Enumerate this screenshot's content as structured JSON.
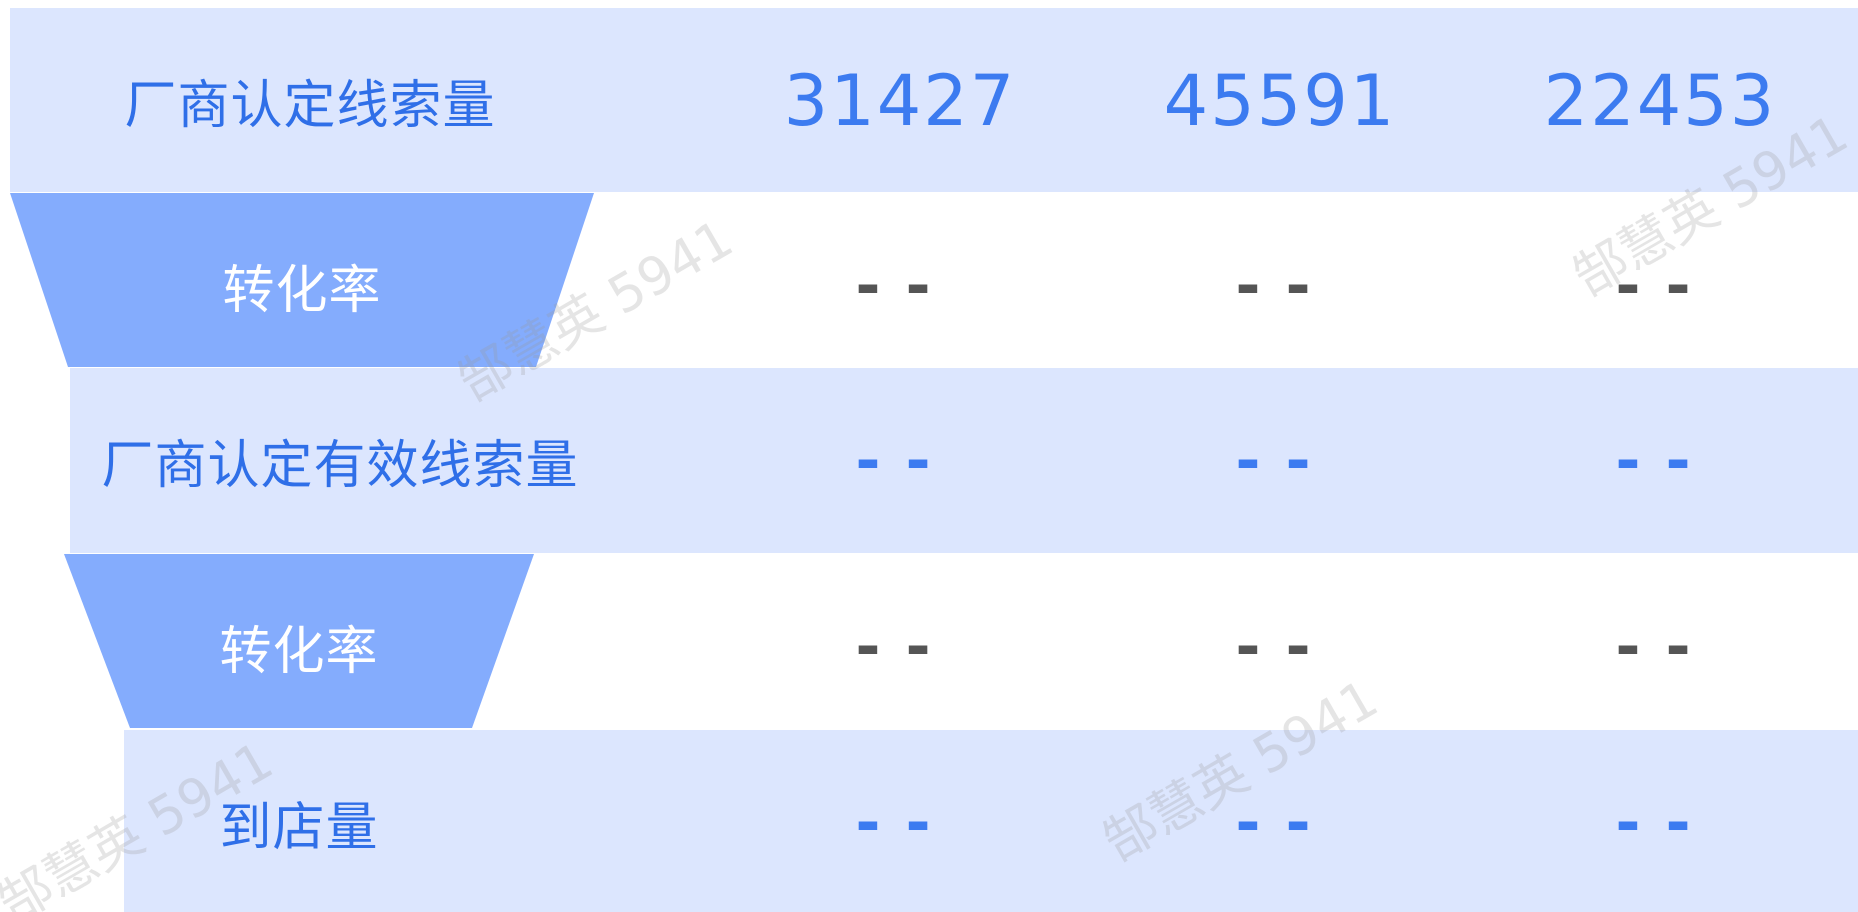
{
  "theme": {
    "band": "#dce6fe",
    "funnel": "#84acfd",
    "accent_text": "#3c7bf0",
    "label_text_on_band": "#2f6fe8",
    "label_text_on_funnel": "#ffffff",
    "dash_on_white": "#555555",
    "watermark": "rgba(150,150,150,0.22)"
  },
  "rows": [
    {
      "label": "厂商认定线索量",
      "values": [
        "31427",
        "45591",
        "22453"
      ]
    },
    {
      "label": "转化率",
      "values": [
        "--",
        "--",
        "--"
      ]
    },
    {
      "label": "厂商认定有效线索量",
      "values": [
        "--",
        "--",
        "--"
      ]
    },
    {
      "label": "转化率",
      "values": [
        "--",
        "--",
        "--"
      ]
    },
    {
      "label": "到店量",
      "values": [
        "--",
        "--",
        "--"
      ]
    }
  ],
  "watermark": {
    "text": "郜慧英 5941"
  }
}
